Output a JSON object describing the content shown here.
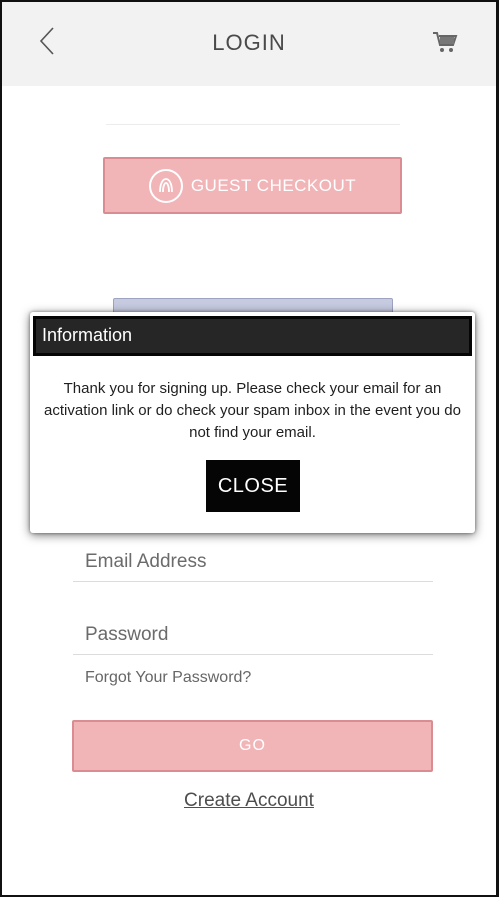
{
  "header": {
    "title": "LOGIN",
    "back_icon": "chevron-left-icon",
    "cart_icon": "cart-icon"
  },
  "guest_checkout": {
    "label": "GUEST CHECKOUT",
    "icon": "lululemon-logo-icon"
  },
  "modal": {
    "title": "Information",
    "message": "Thank you for signing up. Please check your email for an activation link or do check your spam inbox in the event you do not find your email.",
    "close_label": "CLOSE"
  },
  "form": {
    "email_placeholder": "Email Address",
    "email_value": "",
    "password_placeholder": "Password",
    "password_value": "",
    "forgot_label": "Forgot Your Password?",
    "go_label": "GO",
    "create_label": "Create Account"
  },
  "colors": {
    "accent_pink": "#f1b5b8",
    "accent_pink_border": "#d98d92",
    "modal_header": "#262626",
    "close_button": "#050505"
  }
}
